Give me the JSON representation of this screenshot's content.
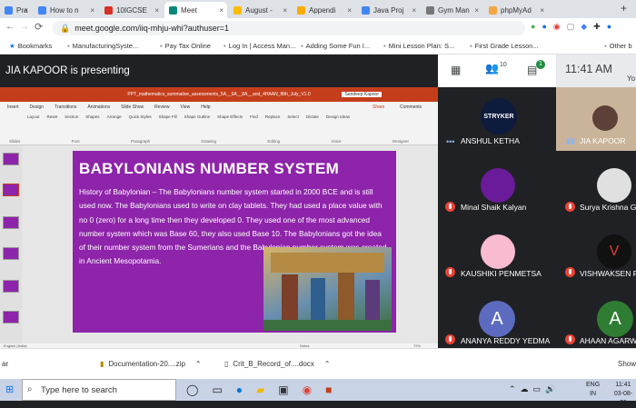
{
  "browser": {
    "tabs": [
      {
        "title": "Pra",
        "color": "#4285f4"
      },
      {
        "title": "How to n",
        "color": "#4285f4"
      },
      {
        "title": "10IGCSE",
        "color": "#d93025"
      },
      {
        "title": "Meet",
        "color": "#00897b"
      },
      {
        "title": "August -",
        "color": "#fbbc04"
      },
      {
        "title": "Appendi",
        "color": "#f9ab00"
      },
      {
        "title": "Java Proj",
        "color": "#4285f4"
      },
      {
        "title": "Gym Man",
        "color": "#777777"
      },
      {
        "title": "phpMyAd",
        "color": "#f4a742"
      }
    ],
    "url": "meet.google.com/iiq-mhju-whi?authuser=1",
    "bookmarks": [
      {
        "label": "Bookmarks"
      },
      {
        "label": "ManufacturingSyste..."
      },
      {
        "label": "Pay Tax Online"
      },
      {
        "label": "Log In | Access Man..."
      },
      {
        "label": "Adding Some Fun I..."
      },
      {
        "label": "Mini Lesson Plan: S..."
      },
      {
        "label": "First Grade Lesson..."
      },
      {
        "label": "Other b"
      }
    ]
  },
  "meet": {
    "presenting_label": "JIA KAPOOR is presenting",
    "participant_count": "10",
    "chat_badge": "1",
    "time": "11:41 AM",
    "self_label": "Yo",
    "participants": [
      {
        "name": "ANSHUL KETHA",
        "muted": false
      },
      {
        "name": "JIA KAPOOR",
        "muted": false
      },
      {
        "name": "Minal Shaik Kalyan",
        "muted": true
      },
      {
        "name": "Surya Krishna Ga",
        "muted": true
      },
      {
        "name": "KAUSHIKI PENMETSA",
        "muted": true
      },
      {
        "name": "VISHWAKSEN R",
        "muted": true
      },
      {
        "name": "ANANYA REDDY YEDMA",
        "muted": true,
        "initial": "A",
        "avatar_color": "#5c6bc0"
      },
      {
        "name": "AHAAN AGARWA",
        "muted": true,
        "initial": "A",
        "avatar_color": "#2e7d32"
      }
    ],
    "stryker_text": "STRYKER"
  },
  "powerpoint": {
    "doc_title": "PPT_mathematics_summative_assessments_5A__6A__8A__and_4HAAN_f8th_July_V1.0",
    "user": "Sandeep Kapoor",
    "ribbon_tabs": [
      "Insert",
      "Design",
      "Transitions",
      "Animations",
      "Slide Show",
      "Review",
      "View",
      "Help"
    ],
    "share_label": "Share",
    "comments_label": "Comments",
    "ribbon_groups": [
      "Slides",
      "Font",
      "Paragraph",
      "Drawing",
      "Editing",
      "Voice",
      "Designer"
    ],
    "ribbon_buttons": [
      "Layout",
      "Reset",
      "Section",
      "Shapes",
      "Arrange",
      "Quick Styles",
      "Shape Fill",
      "Shape Outline",
      "Shape Effects",
      "Find",
      "Replace",
      "Select",
      "Dictate",
      "Design Ideas"
    ],
    "status_left": "English (India)",
    "status_notes": "Notes",
    "zoom": "72%"
  },
  "slide": {
    "title": "BABYLONIANS NUMBER SYSTEM",
    "body": "History of Babylonian – The Babylonians number system started in 2000 BCE and is still used now. The Babylonians used to write on clay tablets. They had used a place value with no 0 (zero) for a long time then they developed 0. They used one of the most advanced number system which was Base 60, they also used Base 10. The Babylonians got the idea of their number system from the Sumerians and the Babylonian number system was created in Ancient Mesopotamia."
  },
  "downloads": [
    {
      "label": "ar"
    },
    {
      "label": "Documentation-20....zip"
    },
    {
      "label": "Crit_B_Record_of....docx"
    },
    {
      "label": "Show"
    }
  ],
  "taskbar": {
    "search_placeholder": "Type here to search",
    "lang_top": "ENG",
    "lang_bottom": "IN",
    "time": "11:41",
    "date": "03-08-20"
  }
}
